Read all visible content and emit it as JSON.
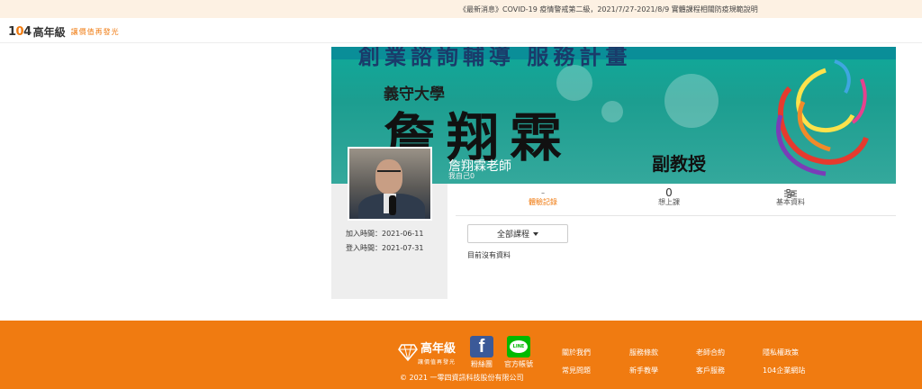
{
  "announcement": "《最新消息》COVID-19 疫情警戒第二級，2021/7/27-2021/8/9 實體課程相關防疫規範說明",
  "header": {
    "logo_number_prefix": "1",
    "logo_number_mid": "0",
    "logo_number_suffix": "4",
    "logo_brand": "高年級",
    "logo_slogan": "讓價值再發光"
  },
  "banner": {
    "top_text": "創業諮詢輔導 服務計畫",
    "university": "義守大學",
    "big_name": "詹翔霖",
    "rank": "副教授"
  },
  "teacher": {
    "name": "詹翔霖老師",
    "subtitle": "我自己0",
    "joined": "加入時間：2021-06-11",
    "last_login": "登入時間：2021-07-31"
  },
  "tabs": [
    {
      "count": "-",
      "label": "體驗記錄"
    },
    {
      "count": "0",
      "label": "想上課"
    },
    {
      "count": "",
      "label": "基本資料",
      "icon": "sliders-icon"
    }
  ],
  "filter": {
    "label": "全部課程"
  },
  "empty_text": "目前沒有資料",
  "footer": {
    "brand": "高年級",
    "slogan": "讓價值再發光",
    "facebook_label": "粉絲團",
    "line_label": "官方帳號",
    "line_icon_text": "LINE",
    "copyright": "© 2021 一零四資訊科技股份有限公司",
    "links": [
      "關於我們",
      "服務條款",
      "老師合約",
      "隱私權政策",
      "常見問題",
      "新手教學",
      "客戶服務",
      "104企業網站"
    ]
  },
  "colors": {
    "brand_orange": "#f07b11",
    "announce_bg": "#fdf1e3",
    "facebook_blue": "#3b5998",
    "line_green": "#00b900"
  }
}
